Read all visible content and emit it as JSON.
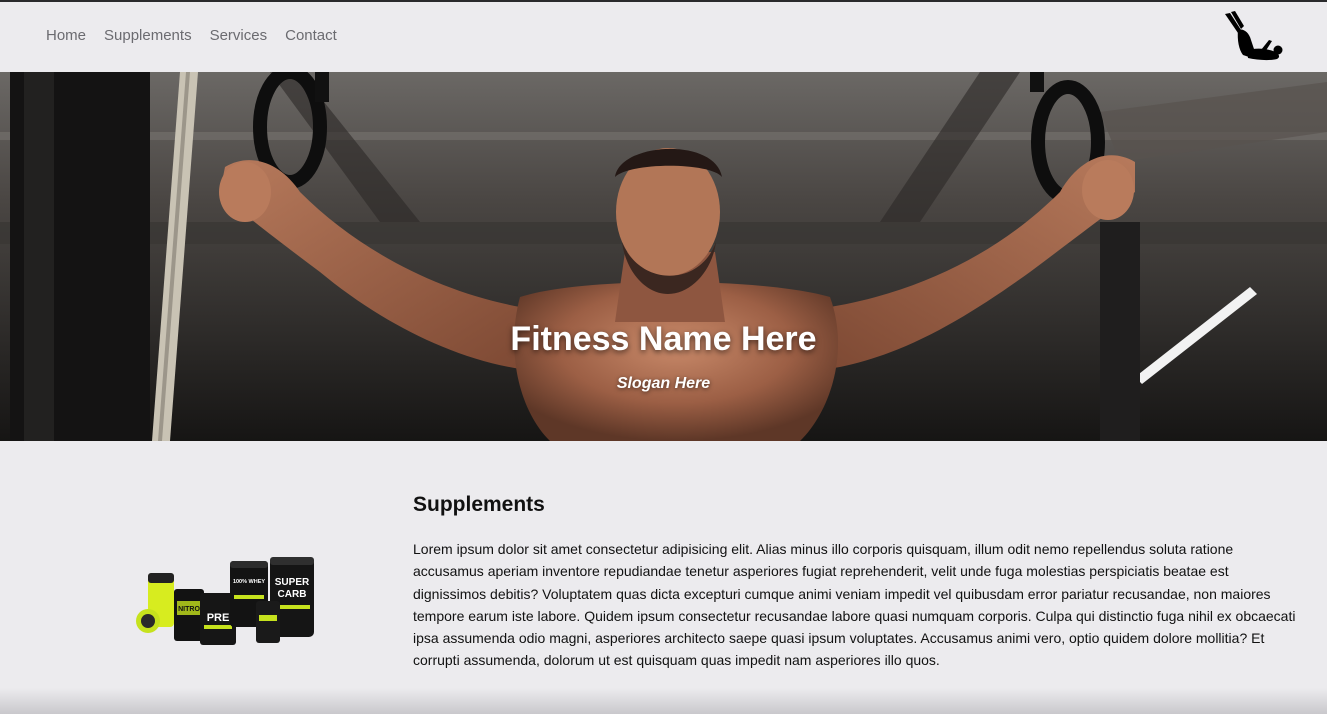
{
  "nav": {
    "links": [
      "Home",
      "Supplements",
      "Services",
      "Contact"
    ],
    "logo_icon": "gymnast-silhouette-icon"
  },
  "hero": {
    "title": "Fitness Name Here",
    "slogan": "Slogan Here",
    "image": "athlete-on-gymnastic-rings-photo"
  },
  "supplements": {
    "title": "Supplements",
    "image": "supplement-containers-photo",
    "body": "Lorem ipsum dolor sit amet consectetur adipisicing elit. Alias minus illo corporis quisquam, illum odit nemo repellendus soluta ratione accusamus aperiam inventore repudiandae tenetur asperiores fugiat reprehenderit, velit unde fuga molestias perspiciatis beatae est dignissimos debitis? Voluptatem quas dicta excepturi cumque animi veniam impedit vel quibusdam error pariatur recusandae, non maiores tempore earum iste labore. Quidem ipsum consectetur recusandae labore quasi numquam corporis. Culpa qui distinctio fuga nihil ex obcaecati ipsa assumenda odio magni, asperiores architecto saepe quasi ipsum voluptates. Accusamus animi vero, optio quidem dolore mollitia? Et corrupti assumenda, dolorum ut est quisquam quas impedit nam asperiores illo quos.",
    "product_labels": [
      "NITRO",
      "PRE",
      "100% WHEY PROTEIN ISOLATE",
      "SUPER CARB"
    ]
  },
  "colors": {
    "background": "#ecebee",
    "nav_text": "#6b6b70",
    "text": "#111111",
    "accent_green": "#c6e21d"
  }
}
